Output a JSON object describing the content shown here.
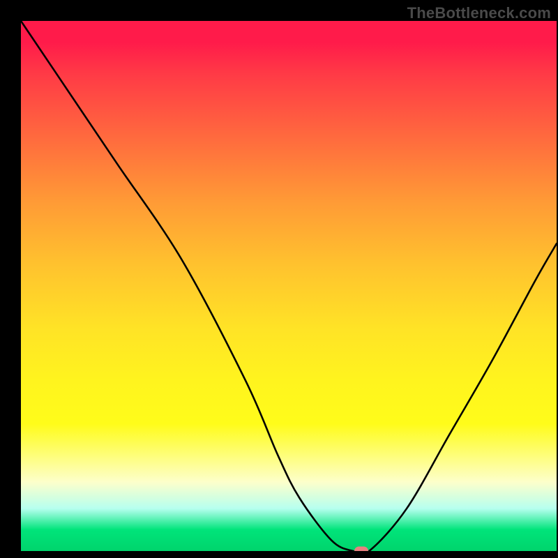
{
  "watermark": "TheBottleneck.com",
  "chart_data": {
    "type": "line",
    "title": "",
    "xlabel": "",
    "ylabel": "",
    "xlim": [
      0,
      100
    ],
    "ylim": [
      0,
      100
    ],
    "grid": false,
    "legend": false,
    "watermark_text": "TheBottleneck.com",
    "background_style": "vertical gradient: red (top) → orange → yellow → pale → green (bottom)",
    "series": [
      {
        "name": "bottleneck-curve",
        "color": "#000000",
        "x": [
          0,
          8,
          18,
          30,
          42,
          48,
          52,
          58,
          62,
          65,
          72,
          80,
          88,
          96,
          100
        ],
        "y": [
          100,
          88,
          73,
          55,
          32,
          18,
          10,
          2,
          0,
          0,
          8,
          22,
          36,
          51,
          58
        ]
      }
    ],
    "marker": {
      "x": 63.5,
      "y": 0,
      "color": "#e98080",
      "shape": "pill"
    }
  }
}
